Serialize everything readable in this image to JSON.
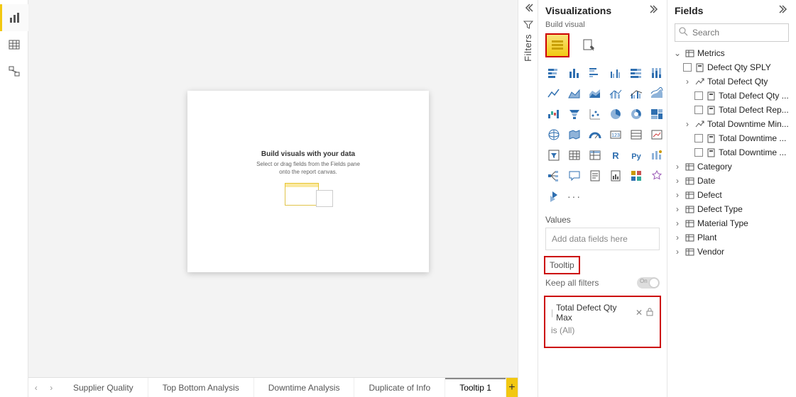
{
  "rail": {
    "report": "Report view",
    "data": "Data view",
    "model": "Model view"
  },
  "filters": {
    "label": "Filters"
  },
  "viz": {
    "title": "Visualizations",
    "sub": "Build visual",
    "values_label": "Values",
    "values_placeholder": "Add data fields here",
    "tooltip_label": "Tooltip",
    "keep_all": "Keep all filters",
    "switch_on": "On",
    "tooltip_field": {
      "name": "Total Defect Qty Max",
      "filter": "is (All)"
    }
  },
  "fields": {
    "title": "Fields",
    "search_placeholder": "Search",
    "metrics": "Metrics",
    "defect_qty_sply": "Defect Qty SPLY",
    "total_defect_qty": "Total Defect Qty",
    "total_defect_qty_c1": "Total Defect Qty ...",
    "total_defect_rep": "Total Defect Rep...",
    "total_downtime_min": "Total Downtime Min...",
    "total_downtime_c1": "Total Downtime ...",
    "total_downtime_c2": "Total Downtime ...",
    "category": "Category",
    "date": "Date",
    "defect": "Defect",
    "defect_type": "Defect Type",
    "material_type": "Material Type",
    "plant": "Plant",
    "vendor": "Vendor"
  },
  "canvas": {
    "ph_title": "Build visuals with your data",
    "ph_sub1": "Select or drag fields from the Fields pane",
    "ph_sub2": "onto the report canvas."
  },
  "tabs": {
    "items": [
      "Supplier Quality",
      "Top Bottom Analysis",
      "Downtime Analysis",
      "Duplicate of Info",
      "Tooltip 1"
    ],
    "active_index": 4,
    "add": "+"
  }
}
